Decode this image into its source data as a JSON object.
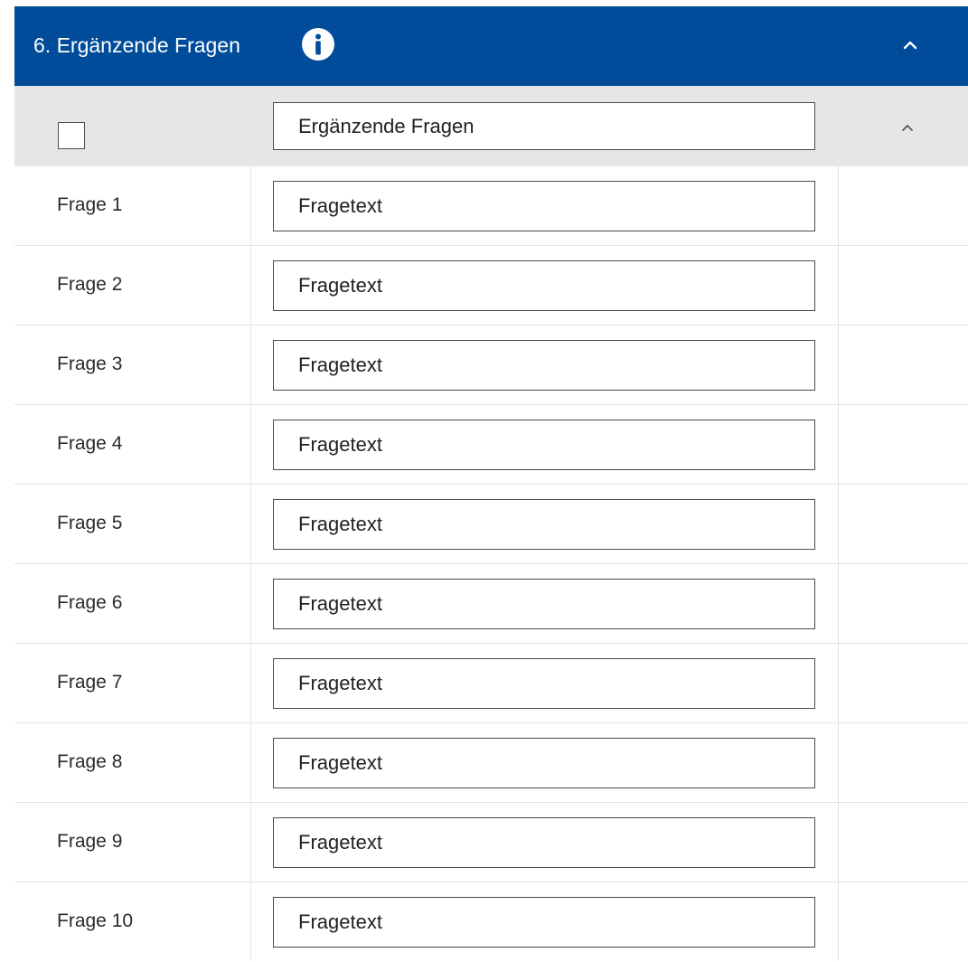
{
  "section": {
    "title": "6. Ergänzende Fragen",
    "info_icon": "info-icon",
    "collapse_icon": "chevron-up-icon",
    "accent_color": "#004c9a"
  },
  "group": {
    "checkbox_checked": false,
    "title_value": "Ergänzende Fragen",
    "collapse_icon": "chevron-up-icon",
    "background_color": "#e6e6e6"
  },
  "questions": [
    {
      "label": "Frage 1",
      "value": "Fragetext"
    },
    {
      "label": "Frage 2",
      "value": "Fragetext"
    },
    {
      "label": "Frage 3",
      "value": "Fragetext"
    },
    {
      "label": "Frage 4",
      "value": "Fragetext"
    },
    {
      "label": "Frage 5",
      "value": "Fragetext"
    },
    {
      "label": "Frage 6",
      "value": "Fragetext"
    },
    {
      "label": "Frage 7",
      "value": "Fragetext"
    },
    {
      "label": "Frage 8",
      "value": "Fragetext"
    },
    {
      "label": "Frage 9",
      "value": "Fragetext"
    },
    {
      "label": "Frage 10",
      "value": "Fragetext"
    }
  ]
}
